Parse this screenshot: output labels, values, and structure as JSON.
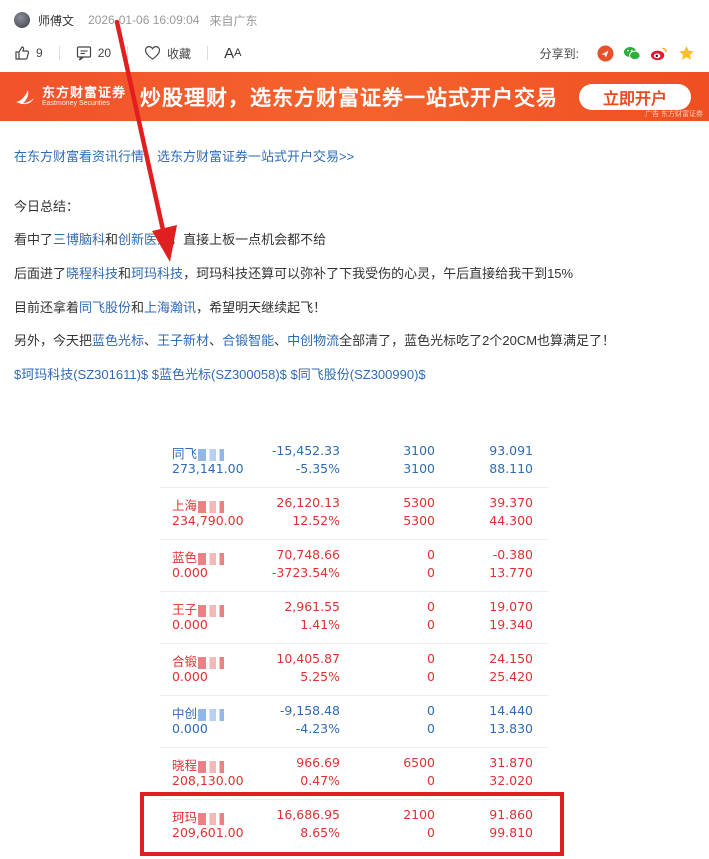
{
  "post": {
    "author": "师傅文",
    "time": "2026-01-06 16:09:04",
    "location": "来自广东"
  },
  "actions": {
    "like_count": "9",
    "comment_count": "20",
    "favorite_label": "收藏",
    "font_label_big": "A",
    "font_label_small": "A",
    "share_label": "分享到:"
  },
  "banner": {
    "logo_cn": "东方财富证券",
    "logo_en": "Eastmoney Securities",
    "slogan": "炒股理财，选东方财富证券一站式开户交易",
    "button": "立即开户",
    "ad_tag": "广告 东方财富证券"
  },
  "promo_link": "在东方财富看资讯行情，选东方财富证券一站式开户交易>>",
  "content": {
    "summary": "今日总结：",
    "p1": {
      "a": "看中了",
      "l1": "三博脑科",
      "b": "和",
      "l2": "创新医疗",
      "c": "，直接上板一点机会都不给"
    },
    "p2": {
      "a": "后面进了",
      "l1": "晓程科技",
      "b": "和",
      "l2": "珂玛科技",
      "c": "，珂玛科技还算可以弥补了下我受伤的心灵，午后直接给我干到15%"
    },
    "p3": {
      "a": "目前还拿着",
      "l1": "同飞股份",
      "b": "和",
      "l2": "上海瀚讯",
      "c": "，希望明天继续起飞！"
    },
    "p4": {
      "a": "另外，今天把",
      "l1": "蓝色光标",
      "s1": "、",
      "l2": "王子新材",
      "s2": "、",
      "l3": "合锻智能",
      "s3": "、",
      "l4": "中创物流",
      "c": "全部清了，蓝色光标吃了2个20CM也算满足了！"
    },
    "tags": [
      "$珂玛科技(SZ301611)$",
      "$蓝色光标(SZ300058)$",
      "$同飞股份(SZ300990)$"
    ]
  },
  "holdings": [
    {
      "name": "同飞",
      "value": "273,141.00",
      "pl": "-15,452.33",
      "pl_pct": "-5.35%",
      "qty": "3100",
      "avail": "3100",
      "cost": "93.091",
      "price": "88.110",
      "tone": "neg"
    },
    {
      "name": "上海",
      "value": "234,790.00",
      "pl": "26,120.13",
      "pl_pct": "12.52%",
      "qty": "5300",
      "avail": "5300",
      "cost": "39.370",
      "price": "44.300",
      "tone": "pos"
    },
    {
      "name": "蓝色",
      "value": "0.000",
      "pl": "70,748.66",
      "pl_pct": "-3723.54%",
      "qty": "0",
      "avail": "0",
      "cost": "-0.380",
      "price": "13.770",
      "tone": "pos"
    },
    {
      "name": "王子",
      "value": "0.000",
      "pl": "2,961.55",
      "pl_pct": "1.41%",
      "qty": "0",
      "avail": "0",
      "cost": "19.070",
      "price": "19.340",
      "tone": "pos"
    },
    {
      "name": "合锻",
      "value": "0.000",
      "pl": "10,405.87",
      "pl_pct": "5.25%",
      "qty": "0",
      "avail": "0",
      "cost": "24.150",
      "price": "25.420",
      "tone": "pos"
    },
    {
      "name": "中创",
      "value": "0.000",
      "pl": "-9,158.48",
      "pl_pct": "-4.23%",
      "qty": "0",
      "avail": "0",
      "cost": "14.440",
      "price": "13.830",
      "tone": "neg"
    },
    {
      "name": "晓程",
      "value": "208,130.00",
      "pl": "966.69",
      "pl_pct": "0.47%",
      "qty": "6500",
      "avail": "0",
      "cost": "31.870",
      "price": "32.020",
      "tone": "pos"
    },
    {
      "name": "珂玛",
      "value": "209,601.00",
      "pl": "16,686.95",
      "pl_pct": "8.65%",
      "qty": "2100",
      "avail": "0",
      "cost": "91.860",
      "price": "99.810",
      "tone": "pos"
    }
  ],
  "colors": {
    "link": "#2f6bb5",
    "up": "#e03131",
    "down": "#2f6bb5",
    "banner": "#f5632d",
    "annotation": "#e02020"
  }
}
